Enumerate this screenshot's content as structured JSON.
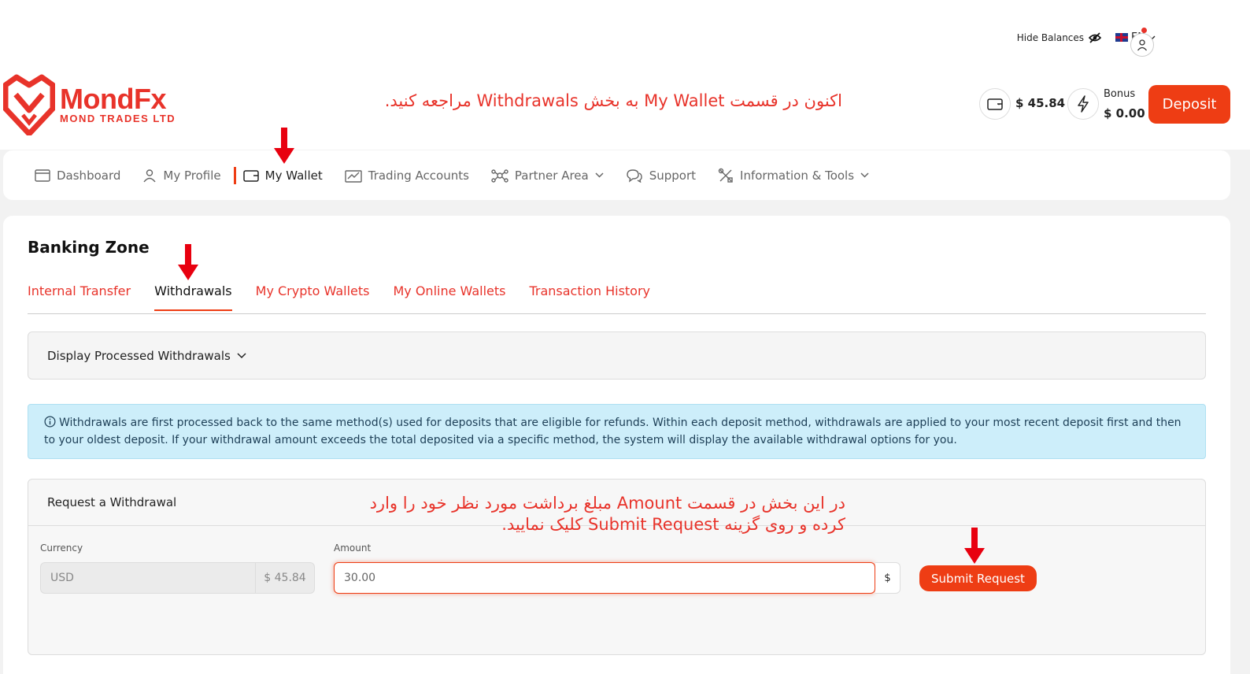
{
  "topbar": {
    "hide_balances": "Hide Balances",
    "language": "EN"
  },
  "logo": {
    "name": "MondFx",
    "tagline": "MOND TRADES LTD"
  },
  "annotations": {
    "top": "اکنون در قسمت My Wallet به بخش Withdrawals مراجعه کنید.",
    "line1": "در این بخش در قسمت Amount مبلغ برداشت مورد نظر خود را وارد",
    "line2": "کرده و روی گزینه Submit Request کلیک نمایید."
  },
  "balances": {
    "wallet": "$ 45.84",
    "bonus_label": "Bonus",
    "bonus_value": "$ 0.00",
    "deposit_label": "Deposit"
  },
  "nav": {
    "dashboard": "Dashboard",
    "profile": "My Profile",
    "wallet": "My Wallet",
    "trading": "Trading Accounts",
    "partner": "Partner Area",
    "support": "Support",
    "info": "Information & Tools"
  },
  "banking": {
    "title": "Banking Zone",
    "tabs": [
      "Internal Transfer",
      "Withdrawals",
      "My Crypto Wallets",
      "My Online Wallets",
      "Transaction History"
    ],
    "processed_label": "Display Processed Withdrawals",
    "info_text": "Withdrawals are first processed back to the same method(s) used for deposits that are eligible for refunds. Within each deposit method, withdrawals are applied to your most recent deposit first and then to your oldest deposit. If your withdrawal amount exceeds the total deposited via a specific method, the system will display the available withdrawal options for you.",
    "request": {
      "title": "Request a Withdrawal",
      "currency_label": "Currency",
      "currency": "USD",
      "currency_balance": "$ 45.84",
      "amount_label": "Amount",
      "amount_value": "30.00",
      "amount_unit": "$",
      "submit_label": "Submit Request"
    }
  },
  "colors": {
    "brand": "#ee3d14",
    "info_bg": "#cdeefa",
    "arrow": "#e8000f"
  }
}
